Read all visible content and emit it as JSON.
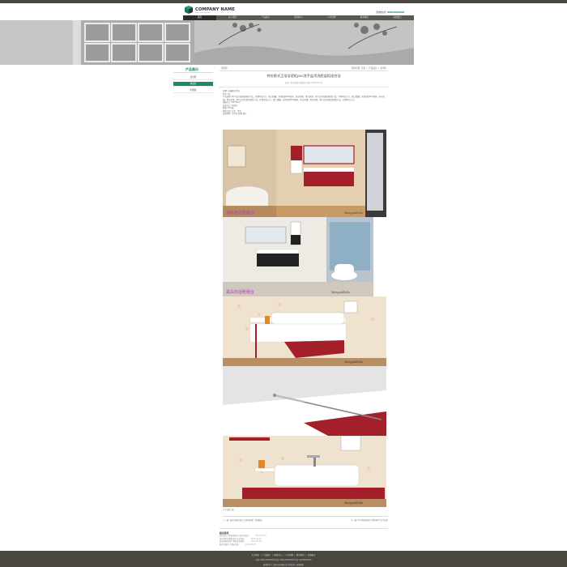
{
  "header": {
    "company_name": "COMPANY NAME",
    "company_sub": "www.company.com",
    "hotline_label": "咨询热线:",
    "hotline_number": "0000000000"
  },
  "nav": [
    "首页",
    "关于我们",
    "产品展示",
    "新闻中心",
    "人才招聘",
    "联系我们",
    "在线留言"
  ],
  "sidebar": {
    "title": "产品展示",
    "items": [
      "浴室柜",
      "淋浴房",
      "坐便器"
    ]
  },
  "main": {
    "breadcrumb_title": "浴室柜",
    "breadcrumb_path": "您的位置: 首页 > 产品展示 > 浴室柜",
    "article_title": "特价欧式卫浴浴室柜pvc洗手盆吊洗脸盆柜组合浴",
    "article_meta": "来源: 本站    编辑: 管理员    日期: 2015-03-16",
    "specs": [
      "品牌: 卓骊德尔卫浴",
      "型号: 01",
      "产品说明: 本产品为优质浴室柜产品，外观时尚大方，做工精细，采用优质PVC板材，防水防潮，经久耐用。本产品为优质浴室柜产品，外观时尚大方，做工精细，采用优质PVC板材，防水防潮，经久耐用。本产品为优质浴室柜产品，外观时尚大方，做工精细，采用优质PVC板材，防水防潮，经久耐用。本产品为优质浴室柜产品，外观时尚大方。",
      "规格尺寸: 80*50cm",
      "安装方式: 挂墙式",
      "材质: PVC板",
      "颜色分类: 红色、黑白",
      "适用场所: 卫生间 浴室 客厅",
      "售后服务: 全国联保 五年质保"
    ],
    "photo_labels": [
      "酒红色浴柜组合",
      "黑白石浴柜组合"
    ],
    "photo_signature": "Mengnadlisha",
    "caption": "点击查看大图",
    "prev": "上一篇: 欧式浴室柜组合 实木浴室柜 卫浴套装",
    "next": "下一篇: PVC浴室柜组合 简约现代 洗手盆柜"
  },
  "related": {
    "title": "相关新闻",
    "items": [
      {
        "text": "特价欧式卫浴浴室柜pvc洗手盆组合",
        "date": "2015-03-16"
      },
      {
        "text": "简约现代浴室柜组合 洗手盆柜",
        "date": "2015-03-12"
      },
      {
        "text": "实木浴室柜组合 落地式浴室柜",
        "date": "2015-03-10"
      },
      {
        "text": "欧式浴室柜 大理石台面",
        "date": "2015-03-08"
      }
    ]
  },
  "footer": {
    "nav": "关于我们 | 产品展示 | 新闻中心 | 人才招聘 | 联系我们 | 在线留言",
    "line1": "电话: 0000-00000000  传真: 0000-00000000  手机: 00000000000",
    "line2": "版权所有 © 某某卫浴有限公司  技术支持: 某某网络"
  },
  "colors": {
    "accent": "#1a8a6a",
    "dark": "#4a4740",
    "cabinet_red": "#a3202a"
  }
}
